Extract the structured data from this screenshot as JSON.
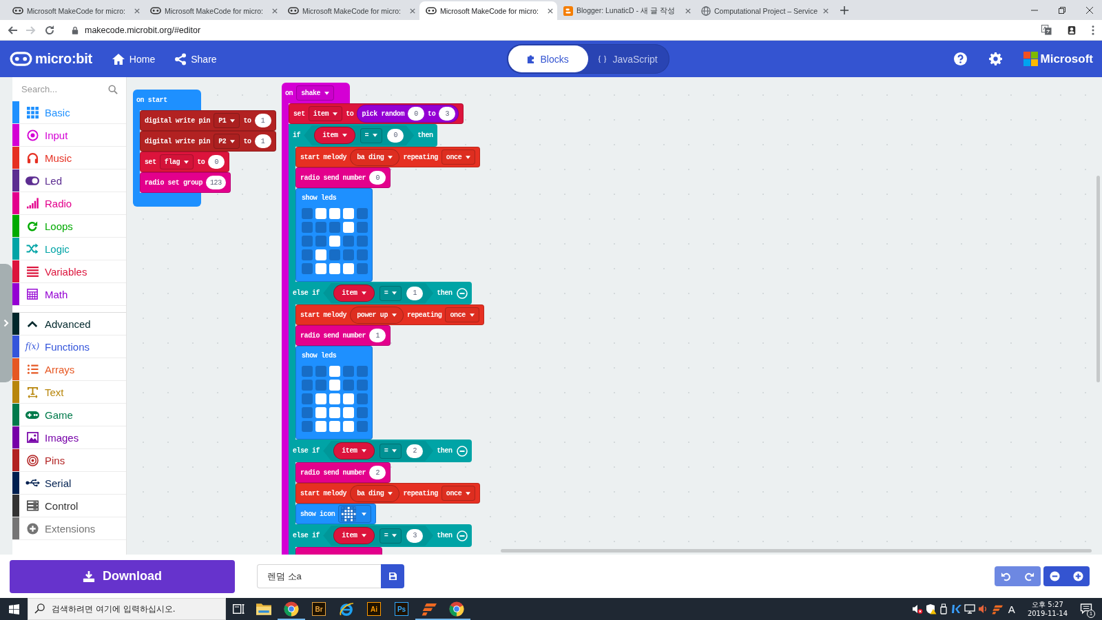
{
  "browser": {
    "tabs": [
      {
        "kind": "face",
        "title": "Microsoft MakeCode for micro:",
        "selected": false
      },
      {
        "kind": "face",
        "title": "Microsoft MakeCode for micro:",
        "selected": false
      },
      {
        "kind": "face",
        "title": "Microsoft MakeCode for micro:",
        "selected": false
      },
      {
        "kind": "face",
        "title": "Microsoft MakeCode for micro:",
        "selected": true
      },
      {
        "kind": "badge",
        "title": "Blogger: LunaticD - 새 글 작성",
        "selected": false
      },
      {
        "kind": "globe",
        "title": "Computational Project – Service",
        "selected": false
      }
    ],
    "nav_buttons": [
      {
        "disabled": false
      },
      {
        "disabled": true
      },
      {
        "disabled": false
      }
    ],
    "url": "makecode.microbit.org/#editor"
  },
  "header": {
    "logo": "micro:bit",
    "nav": [
      {
        "label": "Home"
      },
      {
        "label": "Share"
      }
    ],
    "views": [
      {
        "label": "Blocks",
        "selected": true
      },
      {
        "label": "JavaScript",
        "selected": false
      }
    ],
    "brand": "Microsoft"
  },
  "sidebar": {
    "search": {
      "placeholder": "Search..."
    },
    "categories": [
      {
        "label": "Basic",
        "color": "#1e90ff",
        "selected": false
      },
      {
        "label": "Input",
        "color": "#d400d4",
        "selected": false
      },
      {
        "label": "Music",
        "color": "#e63022",
        "selected": false
      },
      {
        "label": "Led",
        "color": "#5c2d91",
        "selected": false
      },
      {
        "label": "Radio",
        "color": "#e3008c",
        "selected": false
      },
      {
        "label": "Loops",
        "color": "#00aa00",
        "selected": false
      },
      {
        "label": "Logic",
        "color": "#00a4a6",
        "selected": false
      },
      {
        "label": "Variables",
        "color": "#dc143c",
        "selected": false
      },
      {
        "label": "Math",
        "color": "#9400d3",
        "selected": false
      }
    ],
    "advanced": {
      "label": "Advanced",
      "color": "#00272b",
      "expanded": true
    },
    "advanced_categories": [
      {
        "label": "Functions",
        "color": "#3455db",
        "symbol": "f(x)",
        "selected": false
      },
      {
        "label": "Arrays",
        "color": "#e65722",
        "selected": false
      },
      {
        "label": "Text",
        "color": "#b8860b",
        "selected": false
      },
      {
        "label": "Game",
        "color": "#007a4b",
        "selected": false
      },
      {
        "label": "Images",
        "color": "#7600a8",
        "selected": false
      },
      {
        "label": "Pins",
        "color": "#b22222",
        "selected": false
      },
      {
        "label": "Serial",
        "color": "#002050",
        "selected": false
      },
      {
        "label": "Control",
        "color": "#333333",
        "selected": false
      },
      {
        "label": "Extensions",
        "color": "#757575",
        "selected": false
      }
    ]
  },
  "workspace": {
    "stacks": [
      {
        "kind": "hat",
        "color": "#1e90ff",
        "parts": [
          {
            "kind": "label",
            "text": "on start"
          }
        ],
        "body": [
          {
            "kind": "statement",
            "color": "#b22222",
            "parts": [
              {
                "kind": "label",
                "text": "digital write pin"
              },
              {
                "kind": "dropdown",
                "text": "P1"
              },
              {
                "kind": "label",
                "text": "to"
              },
              {
                "kind": "number",
                "text": "1"
              }
            ]
          },
          {
            "kind": "statement",
            "color": "#b22222",
            "parts": [
              {
                "kind": "label",
                "text": "digital write pin"
              },
              {
                "kind": "dropdown",
                "text": "P2"
              },
              {
                "kind": "label",
                "text": "to"
              },
              {
                "kind": "number",
                "text": "1"
              }
            ]
          },
          {
            "kind": "statement",
            "color": "#dc143c",
            "parts": [
              {
                "kind": "label",
                "text": "set"
              },
              {
                "kind": "dropdown",
                "text": "flag"
              },
              {
                "kind": "label",
                "text": "to"
              },
              {
                "kind": "number",
                "text": "0"
              }
            ]
          },
          {
            "kind": "statement",
            "color": "#e3008c",
            "parts": [
              {
                "kind": "label",
                "text": "radio set group"
              },
              {
                "kind": "number",
                "text": "123"
              }
            ]
          }
        ]
      },
      {
        "kind": "hat",
        "color": "#d400d4",
        "parts": [
          {
            "kind": "label",
            "text": "on"
          },
          {
            "kind": "dropdown",
            "text": "shake"
          }
        ],
        "body": [
          {
            "kind": "statement",
            "color": "#dc143c",
            "parts": [
              {
                "kind": "label",
                "text": "set"
              },
              {
                "kind": "dropdown",
                "text": "item"
              },
              {
                "kind": "label",
                "text": "to"
              },
              {
                "kind": "reporter",
                "color": "#9400d3",
                "parts": [
                  {
                    "kind": "label",
                    "text": "pick random"
                  },
                  {
                    "kind": "number",
                    "text": "0"
                  },
                  {
                    "kind": "label",
                    "text": "to"
                  },
                  {
                    "kind": "number",
                    "text": "3"
                  }
                ]
              }
            ]
          },
          {
            "kind": "if",
            "color": "#00a4a6",
            "sections": [
              {
                "parts": [
                  {
                    "kind": "label",
                    "text": "if"
                  },
                  {
                    "kind": "compare",
                    "parts": [
                      {
                        "kind": "variable",
                        "color": "#dc143c",
                        "text": "item"
                      },
                      {
                        "kind": "dropdown",
                        "text": "="
                      },
                      {
                        "kind": "number",
                        "text": "0"
                      }
                    ]
                  },
                  {
                    "kind": "label",
                    "text": "then"
                  }
                ],
                "body": [
                  {
                    "kind": "statement",
                    "color": "#e63022",
                    "parts": [
                      {
                        "kind": "label",
                        "text": "start melody"
                      },
                      {
                        "kind": "melody",
                        "text": "ba ding"
                      },
                      {
                        "kind": "label",
                        "text": "repeating"
                      },
                      {
                        "kind": "dropdown",
                        "text": "once"
                      }
                    ]
                  },
                  {
                    "kind": "statement",
                    "color": "#e3008c",
                    "parts": [
                      {
                        "kind": "label",
                        "text": "radio send number"
                      },
                      {
                        "kind": "number",
                        "text": "0"
                      }
                    ]
                  },
                  {
                    "kind": "statement",
                    "color": "#1e90ff",
                    "parts": [
                      {
                        "kind": "label",
                        "text": "show leds"
                      },
                      {
                        "kind": "leds",
                        "rows": [
                          [
                            false,
                            true,
                            true,
                            true,
                            false
                          ],
                          [
                            false,
                            false,
                            false,
                            true,
                            false
                          ],
                          [
                            false,
                            false,
                            true,
                            false,
                            false
                          ],
                          [
                            false,
                            true,
                            false,
                            false,
                            false
                          ],
                          [
                            false,
                            true,
                            true,
                            true,
                            false
                          ]
                        ]
                      }
                    ]
                  }
                ]
              },
              {
                "parts": [
                  {
                    "kind": "label",
                    "text": "else if"
                  },
                  {
                    "kind": "compare",
                    "parts": [
                      {
                        "kind": "variable",
                        "color": "#dc143c",
                        "text": "item"
                      },
                      {
                        "kind": "dropdown",
                        "text": "="
                      },
                      {
                        "kind": "number",
                        "text": "1"
                      }
                    ]
                  },
                  {
                    "kind": "label",
                    "text": "then"
                  },
                  {
                    "kind": "remove"
                  }
                ],
                "body": [
                  {
                    "kind": "statement",
                    "color": "#e63022",
                    "parts": [
                      {
                        "kind": "label",
                        "text": "start melody"
                      },
                      {
                        "kind": "melody",
                        "text": "power up"
                      },
                      {
                        "kind": "label",
                        "text": "repeating"
                      },
                      {
                        "kind": "dropdown",
                        "text": "once"
                      }
                    ]
                  },
                  {
                    "kind": "statement",
                    "color": "#e3008c",
                    "parts": [
                      {
                        "kind": "label",
                        "text": "radio send number"
                      },
                      {
                        "kind": "number",
                        "text": "1"
                      }
                    ]
                  },
                  {
                    "kind": "statement",
                    "color": "#1e90ff",
                    "parts": [
                      {
                        "kind": "label",
                        "text": "show leds"
                      },
                      {
                        "kind": "leds",
                        "rows": [
                          [
                            false,
                            false,
                            true,
                            false,
                            false
                          ],
                          [
                            false,
                            false,
                            true,
                            false,
                            false
                          ],
                          [
                            false,
                            true,
                            true,
                            true,
                            false
                          ],
                          [
                            false,
                            true,
                            true,
                            true,
                            false
                          ],
                          [
                            false,
                            true,
                            true,
                            true,
                            false
                          ]
                        ]
                      }
                    ]
                  }
                ]
              },
              {
                "parts": [
                  {
                    "kind": "label",
                    "text": "else if"
                  },
                  {
                    "kind": "compare",
                    "parts": [
                      {
                        "kind": "variable",
                        "color": "#dc143c",
                        "text": "item"
                      },
                      {
                        "kind": "dropdown",
                        "text": "="
                      },
                      {
                        "kind": "number",
                        "text": "2"
                      }
                    ]
                  },
                  {
                    "kind": "label",
                    "text": "then"
                  },
                  {
                    "kind": "remove"
                  }
                ],
                "body": [
                  {
                    "kind": "statement",
                    "color": "#e3008c",
                    "parts": [
                      {
                        "kind": "label",
                        "text": "radio send number"
                      },
                      {
                        "kind": "number",
                        "text": "2"
                      }
                    ]
                  },
                  {
                    "kind": "statement",
                    "color": "#e63022",
                    "parts": [
                      {
                        "kind": "label",
                        "text": "start melody"
                      },
                      {
                        "kind": "melody",
                        "text": "ba ding"
                      },
                      {
                        "kind": "label",
                        "text": "repeating"
                      },
                      {
                        "kind": "dropdown",
                        "text": "once"
                      }
                    ]
                  },
                  {
                    "kind": "statement",
                    "color": "#1e90ff",
                    "parts": [
                      {
                        "kind": "label",
                        "text": "show icon"
                      },
                      {
                        "kind": "icon_picker"
                      }
                    ]
                  }
                ]
              },
              {
                "parts": [
                  {
                    "kind": "label",
                    "text": "else if"
                  },
                  {
                    "kind": "compare",
                    "parts": [
                      {
                        "kind": "variable",
                        "color": "#dc143c",
                        "text": "item"
                      },
                      {
                        "kind": "dropdown",
                        "text": "="
                      },
                      {
                        "kind": "number",
                        "text": "3"
                      }
                    ]
                  },
                  {
                    "kind": "label",
                    "text": "then"
                  },
                  {
                    "kind": "remove"
                  }
                ],
                "body": [
                  {
                    "kind": "statement",
                    "color": "#e3008c"
                  }
                ]
              }
            ]
          }
        ]
      }
    ]
  },
  "toolbar": {
    "download": "Download",
    "project_name": "렌덤 소a",
    "history_buttons": [
      {
        "disabled": true
      },
      {
        "disabled": true
      }
    ]
  },
  "taskbar": {
    "search": {
      "placeholder": "검색하려면 여기에 입력하십시오."
    },
    "apps": [
      {
        "kind": "folder",
        "running": false
      },
      {
        "kind": "browser",
        "running": true
      },
      {
        "kind": "badge",
        "label": "Br",
        "color": "#e8a33d",
        "running": false
      },
      {
        "kind": "ring",
        "running": false
      },
      {
        "kind": "badge",
        "label": "Ai",
        "color": "#ff9a00",
        "running": false
      },
      {
        "kind": "badge",
        "label": "Ps",
        "color": "#31a8ff",
        "running": false
      },
      {
        "kind": "stripes",
        "running": true
      },
      {
        "kind": "browser",
        "running": true
      }
    ],
    "tray": {
      "ime": "A",
      "time": "오후 5:27",
      "date": "2019-11-14",
      "notifications": "1"
    }
  }
}
